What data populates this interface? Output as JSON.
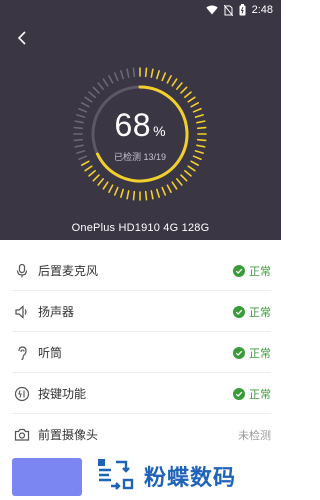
{
  "status_bar": {
    "time": "2:48",
    "icons": [
      "wifi-icon",
      "no-sim-icon",
      "battery-icon"
    ]
  },
  "header": {
    "back_icon": "chevron-left-icon"
  },
  "gauge": {
    "percent": "68",
    "percent_unit": "%",
    "progress_text": "已检测 13/19",
    "fraction": 0.68
  },
  "device": {
    "name": "OnePlus HD1910 4G 128G"
  },
  "checks": [
    {
      "label": "后置麦克风",
      "icon": "microphone-icon",
      "status": "正常",
      "state": "ok"
    },
    {
      "label": "扬声器",
      "icon": "speaker-icon",
      "status": "正常",
      "state": "ok"
    },
    {
      "label": "听筒",
      "icon": "earpiece-icon",
      "status": "正常",
      "state": "ok"
    },
    {
      "label": "按键功能",
      "icon": "power-button-icon",
      "status": "正常",
      "state": "ok"
    },
    {
      "label": "前置摄像头",
      "icon": "camera-icon",
      "status": "未检测",
      "state": "pending"
    }
  ],
  "watermark": {
    "text": "粉蝶数码"
  },
  "colors": {
    "hero_bg": "#3a3644",
    "gauge_accent": "#f2cf2a",
    "ok_green": "#3a9b3a",
    "button": "#7b86f2"
  }
}
